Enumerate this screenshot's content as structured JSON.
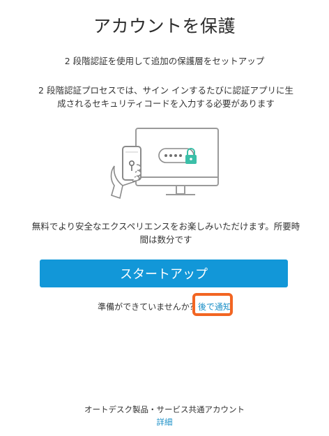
{
  "header": {
    "title": "アカウントを保護"
  },
  "intro": {
    "subtitle": "2 段階認証を使用して追加の保護層をセットアップ",
    "description": "2 段階認証プロセスでは、サイン インするたびに認証アプリに生成されるセキュリティコードを入力する必要があります"
  },
  "illustration": {
    "icons": [
      "monitor-icon",
      "smartphone-icon",
      "lock-icon",
      "hand-icon"
    ],
    "accent_color": "#3bbfa8"
  },
  "benefit": {
    "text": "無料でより安全なエクスペリエンスをお楽しみいただけます。所要時間は数分です"
  },
  "actions": {
    "start_label": "スタートアップ",
    "not_ready_text": "準備ができていませんか？",
    "remind_later_label": "後で通知",
    "primary_color": "#1297d8",
    "highlight_color": "#f26522"
  },
  "footer": {
    "text": "オートデスク製品・サービス共通アカウント",
    "link_label": "詳細"
  }
}
